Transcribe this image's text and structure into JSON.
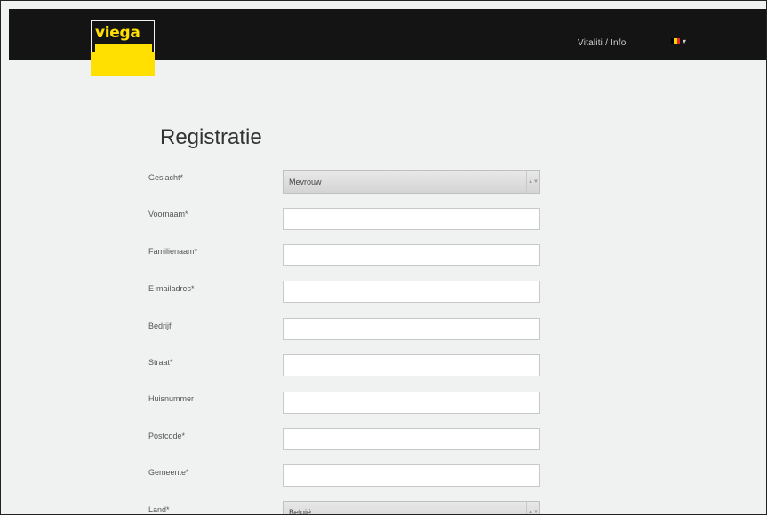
{
  "header": {
    "logo_text": "viega",
    "top_links": "Vitaliti / Info",
    "flag_colors": [
      "#000000",
      "#f4d800",
      "#e8242c"
    ],
    "flag_name": "belgium-flag-icon"
  },
  "page": {
    "title": "Registratie"
  },
  "form": {
    "fields": [
      {
        "label": "Geslacht*",
        "type": "select",
        "value": "Mevrouw"
      },
      {
        "label": "Voornaam*",
        "type": "text",
        "value": ""
      },
      {
        "label": "Familienaam*",
        "type": "text",
        "value": ""
      },
      {
        "label": "E-mailadres*",
        "type": "text",
        "value": ""
      },
      {
        "label": "Bedrijf",
        "type": "text",
        "value": ""
      },
      {
        "label": "Straat*",
        "type": "text",
        "value": ""
      },
      {
        "label": "Huisnummer",
        "type": "text",
        "value": ""
      },
      {
        "label": "Postcode*",
        "type": "text",
        "value": ""
      },
      {
        "label": "Gemeente*",
        "type": "text",
        "value": ""
      },
      {
        "label": "Land*",
        "type": "select",
        "value": "België"
      }
    ]
  },
  "colors": {
    "brand_yellow": "#ffe000",
    "header_bg": "#141414",
    "page_bg": "#f0f1f1"
  }
}
